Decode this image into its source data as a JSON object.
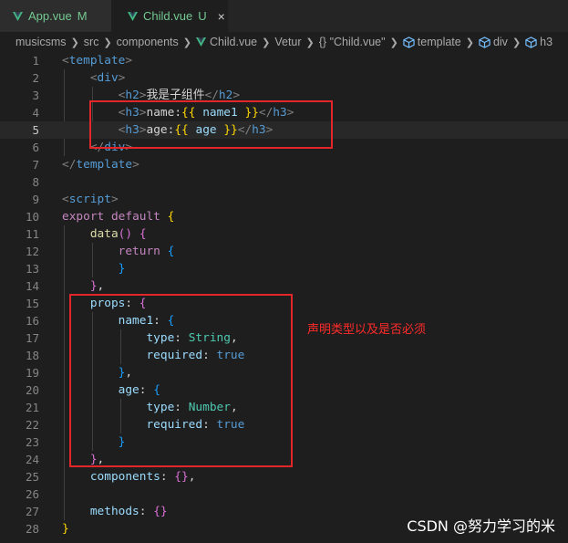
{
  "tabs": [
    {
      "name": "App.vue",
      "badge": "M",
      "active": false
    },
    {
      "name": "Child.vue",
      "badge": "U",
      "active": true,
      "close": "×"
    }
  ],
  "breadcrumb": [
    "musicsms",
    "src",
    "components",
    "Child.vue",
    "Vetur",
    "{} \"Child.vue\"",
    "template",
    "div",
    "h3"
  ],
  "editor": {
    "active_line": 5,
    "line_numbers": [
      "1",
      "2",
      "3",
      "4",
      "5",
      "6",
      "7",
      "8",
      "9",
      "10",
      "11",
      "12",
      "13",
      "14",
      "15",
      "16",
      "17",
      "18",
      "19",
      "20",
      "21",
      "22",
      "23",
      "24",
      "25",
      "26",
      "27",
      "28"
    ],
    "lines": [
      "<template>",
      "    <div>",
      "        <h2>我是子组件</h2>",
      "        <h3>name:{{ name1 }}</h3>",
      "        <h3>age:{{ age }}</h3>",
      "    </div>",
      "</template>",
      "",
      "<script>",
      "export default {",
      "    data() {",
      "        return {",
      "        }",
      "    },",
      "    props: {",
      "        name1: {",
      "            type: String,",
      "            required: true",
      "        },",
      "        age: {",
      "            type: Number,",
      "            required: true",
      "        }",
      "    },",
      "    components: {},",
      "",
      "    methods: {}",
      "}"
    ]
  },
  "annotation": "声明类型以及是否必须",
  "watermark": "CSDN @努力学习的米",
  "colors": {
    "highlight_box": "#e3262a",
    "modified_file": "#73c991"
  }
}
